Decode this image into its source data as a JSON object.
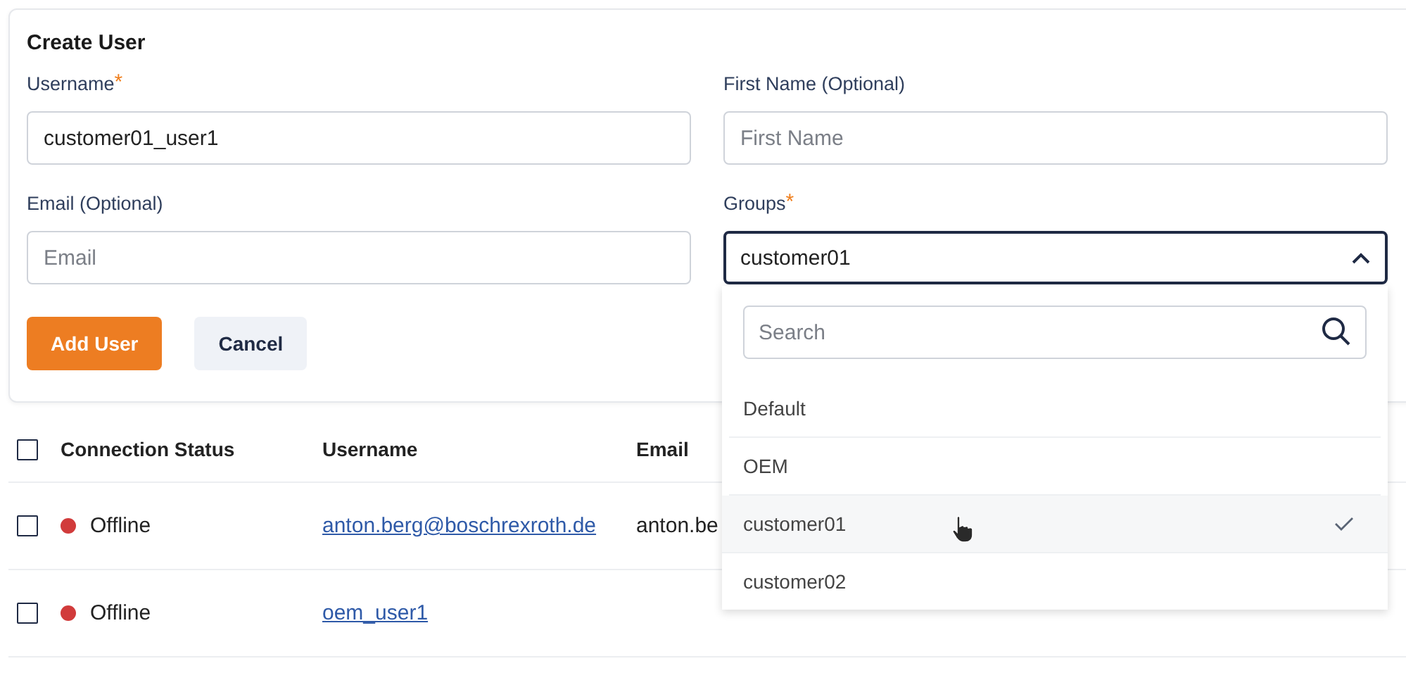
{
  "form": {
    "title": "Create User",
    "fields": [
      {
        "kind": "text",
        "label": "Username",
        "required_mark": "*",
        "value": "customer01_user1"
      },
      {
        "kind": "text",
        "label": "First Name (Optional)",
        "placeholder": "First Name"
      },
      {
        "kind": "text",
        "label": "Email (Optional)",
        "placeholder": "Email"
      },
      {
        "kind": "select",
        "label": "Groups",
        "required_mark": "*",
        "value": "customer01",
        "expanded": true
      }
    ],
    "buttons": [
      {
        "kind": "primary",
        "label": "Add User"
      },
      {
        "kind": "secondary",
        "label": "Cancel"
      }
    ]
  },
  "dropdown": {
    "search": {
      "placeholder": "Search"
    },
    "options": [
      {
        "label": "Default",
        "selected": false
      },
      {
        "label": "OEM",
        "selected": false
      },
      {
        "label": "customer01",
        "selected": true
      },
      {
        "label": "customer02",
        "selected": false
      }
    ]
  },
  "table": {
    "select_all": {
      "checked": false
    },
    "columns": [
      {
        "label": "Connection Status"
      },
      {
        "label": "Username"
      },
      {
        "label": "Email"
      }
    ],
    "rows": [
      {
        "checked": false,
        "status": "Offline",
        "color": "#d13b3b",
        "username": "anton.berg@boschrexroth.de",
        "email": "anton.be"
      },
      {
        "checked": false,
        "status": "Offline",
        "color": "#d13b3b",
        "username": "oem_user1"
      }
    ]
  }
}
